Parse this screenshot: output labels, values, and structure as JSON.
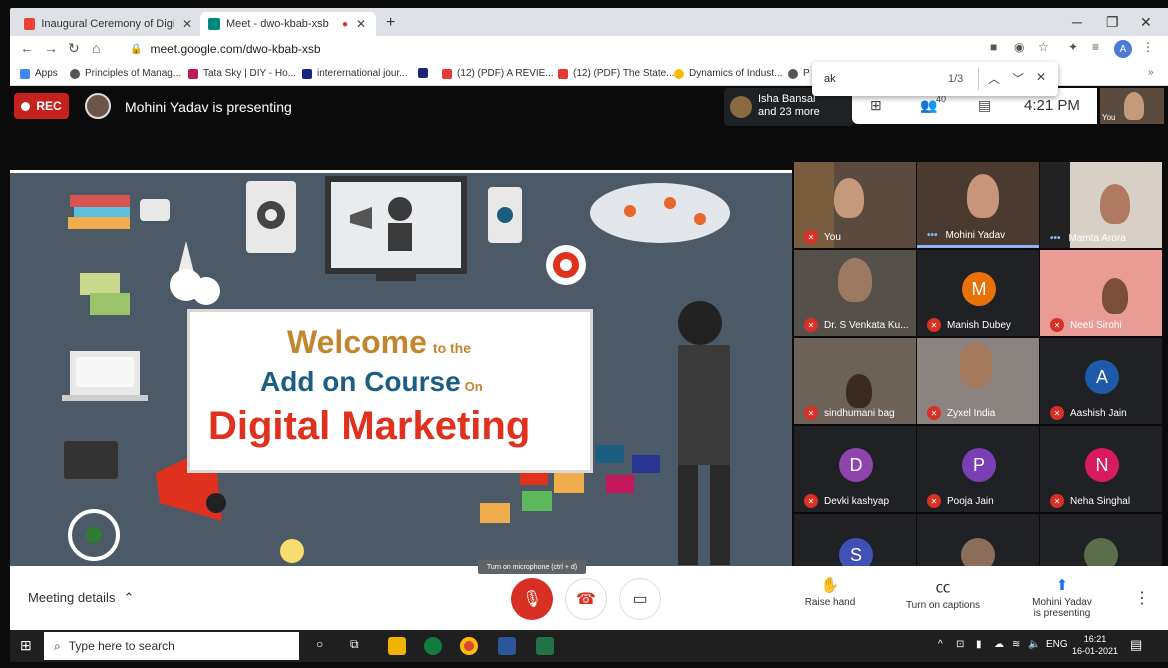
{
  "browser": {
    "tabs": [
      {
        "title": "Inaugural Ceremony of Digital M",
        "active": false
      },
      {
        "title": "Meet - dwo-kbab-xsb",
        "active": true
      }
    ],
    "url": "meet.google.com/dwo-kbab-xsb",
    "profile_initial": "A",
    "bookmarks": [
      "Apps",
      "Principles of Manag...",
      "Tata Sky | DIY - Ho...",
      "interernational jour...",
      "",
      "(12) (PDF) A REVIE...",
      "(12) (PDF) The State...",
      "Dynamics of Indust...",
      "P"
    ]
  },
  "find_bar": {
    "query": "ak",
    "count": "1/3"
  },
  "meet_header": {
    "rec_label": "REC",
    "presenting_text": "Mohini Yadav is presenting",
    "notification_line1": "Isha Bansal",
    "notification_line2": "and 23 more",
    "participant_count": "40",
    "time": "4:21 PM",
    "self_label": "You"
  },
  "slide": {
    "line1": "Welcome",
    "line1_small": "to the",
    "line2": "Add on Course",
    "line2_small": "On",
    "line3": "Digital Marketing"
  },
  "participants": [
    {
      "name": "You",
      "kind": "video"
    },
    {
      "name": "Mohini Yadav",
      "kind": "video"
    },
    {
      "name": "Mamta Arora",
      "kind": "video"
    },
    {
      "name": "Dr. S Venkata Ku...",
      "kind": "video"
    },
    {
      "name": "Manish Dubey",
      "kind": "letter",
      "letter": "M",
      "color": "#e8710a"
    },
    {
      "name": "Neeti Sirohi",
      "kind": "video"
    },
    {
      "name": "sindhumani bag",
      "kind": "video"
    },
    {
      "name": "Zyxel India",
      "kind": "video"
    },
    {
      "name": "Aashish Jain",
      "kind": "letter",
      "letter": "A",
      "color": "#1e5aa8"
    },
    {
      "name": "Devki kashyap",
      "kind": "letter",
      "letter": "D",
      "color": "#8e44ad"
    },
    {
      "name": "Pooja Jain",
      "kind": "letter",
      "letter": "P",
      "color": "#7b3fb5"
    },
    {
      "name": "Neha Singhal",
      "kind": "letter",
      "letter": "N",
      "color": "#d81b60"
    },
    {
      "name": "",
      "kind": "letter",
      "letter": "S",
      "color": "#3f51b5"
    }
  ],
  "controls": {
    "meeting_details": "Meeting details",
    "tooltip": "Turn on microphone (ctrl + d)",
    "raise_hand": "Raise hand",
    "captions": "Turn on captions",
    "presenting_line1": "Mohini Yadav",
    "presenting_line2": "is presenting"
  },
  "taskbar": {
    "search_placeholder": "Type here to search",
    "lang": "ENG",
    "time": "16:21",
    "date": "16-01-2021"
  },
  "colors": {
    "rec": "#c5221f",
    "mic_off": "#d93025",
    "slide_bg": "#4c5966"
  }
}
